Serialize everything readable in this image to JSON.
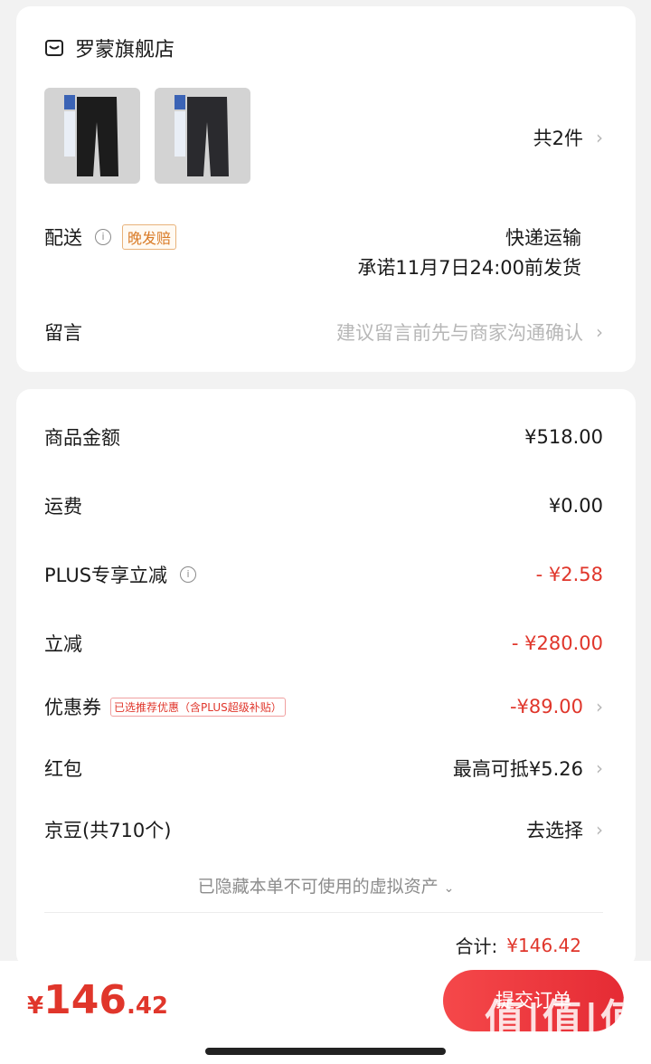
{
  "shop": {
    "name": "罗蒙旗舰店",
    "icon": "store-icon"
  },
  "items": {
    "count_label": "共2件"
  },
  "delivery": {
    "label": "配送",
    "tag": "晚发赔",
    "method": "快递运输",
    "promise": "承诺11月7日24:00前发货"
  },
  "message": {
    "label": "留言",
    "placeholder": "建议留言前先与商家沟通确认"
  },
  "summary": {
    "goods_label": "商品金额",
    "goods_value": "¥518.00",
    "shipping_label": "运费",
    "shipping_value": "¥0.00",
    "plus_label": "PLUS专享立减",
    "plus_value": "- ¥2.58",
    "discount_label": "立减",
    "discount_value": "- ¥280.00",
    "coupon_label": "优惠券",
    "coupon_tag": "已选推荐优惠（含PLUS超级补贴）",
    "coupon_value": "-¥89.00",
    "redpacket_label": "红包",
    "redpacket_value": "最高可抵¥5.26",
    "beans_label": "京豆(共710个)",
    "beans_value": "去选择",
    "hidden_assets": "已隐藏本单不可使用的虚拟资产",
    "total_label": "合计:",
    "total_value": "¥146.42"
  },
  "footer": {
    "yen": "¥",
    "price_int": "146",
    "price_dec": ".42",
    "submit_label": "提交订单"
  },
  "watermark": {
    "text": "值|值|值",
    "url": "zhizhizhi.com"
  },
  "colors": {
    "accent": "#e0362b",
    "tag_orange": "#d97b27"
  }
}
